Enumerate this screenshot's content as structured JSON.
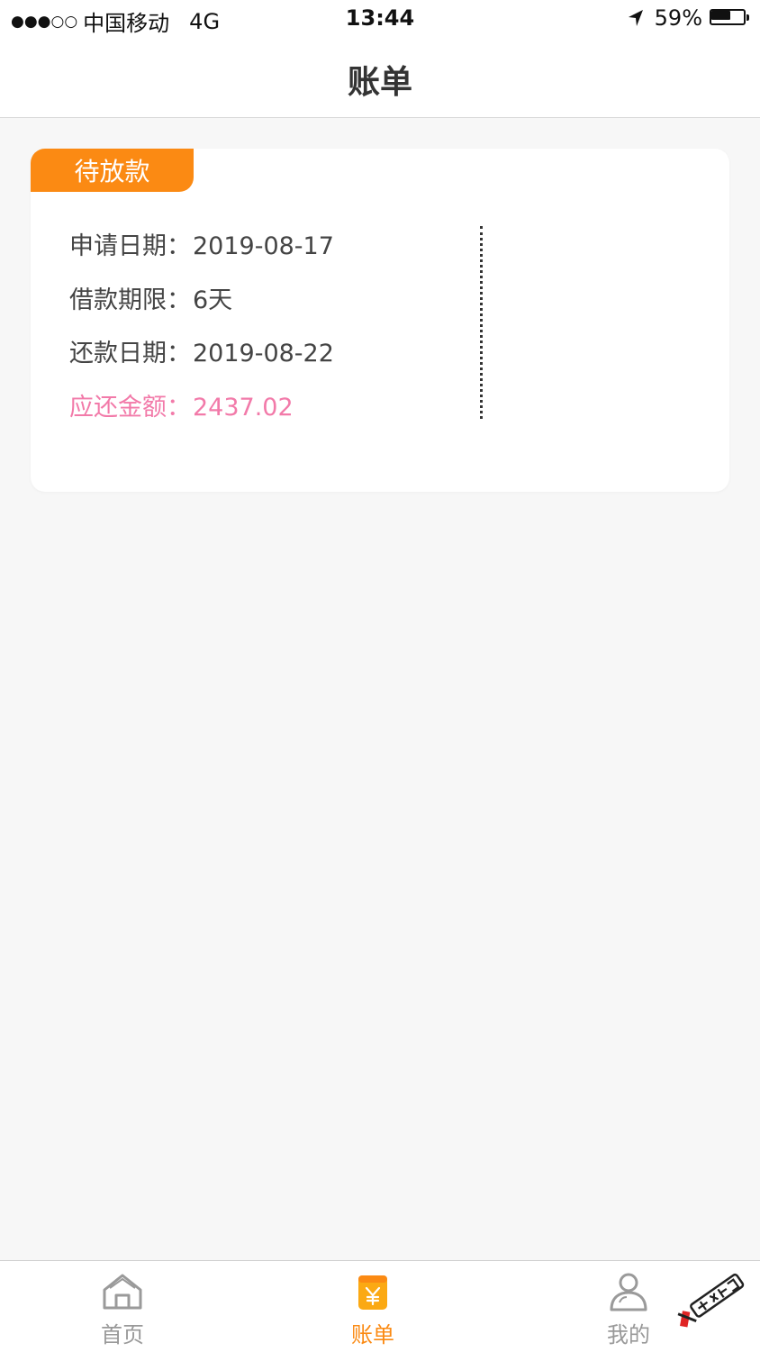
{
  "status_bar": {
    "signal": "●●●○○",
    "carrier": "中国移动",
    "network": "4G",
    "time": "13:44",
    "battery": "59%",
    "battery_level": 0.59
  },
  "nav": {
    "title": "账单"
  },
  "bill": {
    "status": "待放款",
    "apply_date_label": "申请日期：",
    "apply_date": "2019-08-17",
    "term_label": "借款期限：",
    "term": "6天",
    "due_date_label": "还款日期：",
    "due_date": "2019-08-22",
    "amount_label": "应还金额：",
    "amount": "2437.02"
  },
  "tabs": [
    {
      "label": "首页",
      "icon": "home-icon"
    },
    {
      "label": "账单",
      "icon": "bill-icon",
      "active": true
    },
    {
      "label": "我的",
      "icon": "user-icon"
    }
  ],
  "colors": {
    "accent": "#fb8a13",
    "amount": "#f27aa9",
    "inactive": "#999999"
  }
}
